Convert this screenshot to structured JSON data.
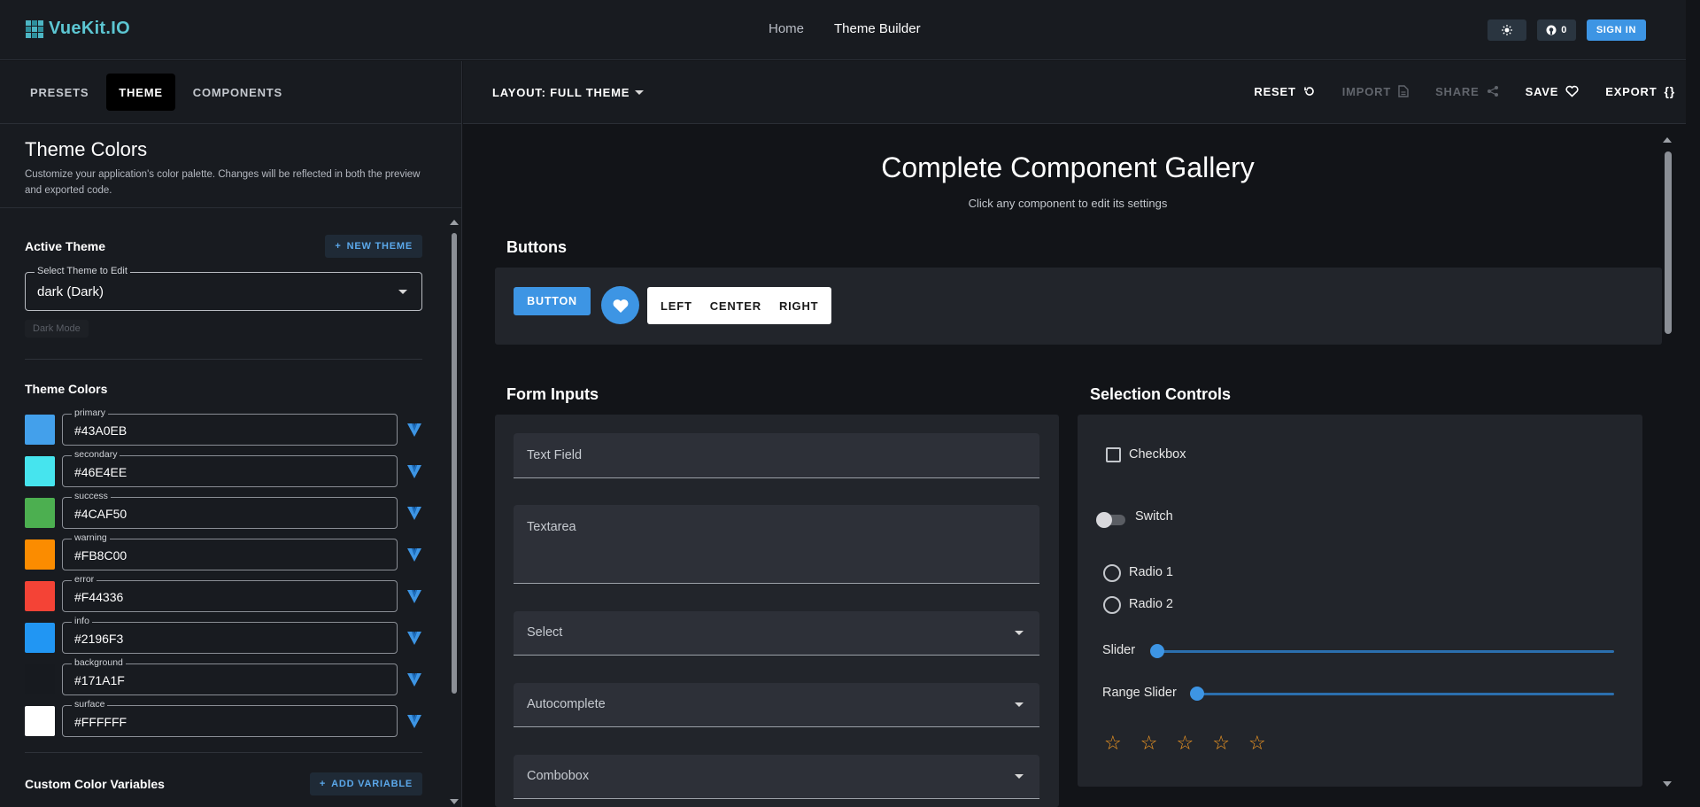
{
  "app": {
    "logo_text": "VueKit.IO",
    "nav": {
      "home": "Home",
      "theme_builder": "Theme Builder"
    },
    "github_count": "0",
    "sign_in": "SIGN IN"
  },
  "left_panel": {
    "tabs": [
      "PRESETS",
      "THEME",
      "COMPONENTS"
    ],
    "active_tab": "THEME",
    "heading": "Theme Colors",
    "description": "Customize your application's color palette. Changes will be reflected in both the preview and exported code.",
    "active_theme": {
      "title": "Active Theme",
      "new_theme_label": "NEW THEME",
      "select_legend": "Select Theme to Edit",
      "select_value": "dark (Dark)",
      "dark_mode_chip": "Dark Mode"
    },
    "theme_colors_title": "Theme Colors",
    "colors": [
      {
        "name": "primary",
        "value": "#43A0EB",
        "swatch": "#43A0EB"
      },
      {
        "name": "secondary",
        "value": "#46E4EE",
        "swatch": "#46E4EE"
      },
      {
        "name": "success",
        "value": "#4CAF50",
        "swatch": "#4CAF50"
      },
      {
        "name": "warning",
        "value": "#FB8C00",
        "swatch": "#FB8C00"
      },
      {
        "name": "error",
        "value": "#F44336",
        "swatch": "#F44336"
      },
      {
        "name": "info",
        "value": "#2196F3",
        "swatch": "#2196F3"
      },
      {
        "name": "background",
        "value": "#171A1F",
        "swatch": "#171A1F"
      },
      {
        "name": "surface",
        "value": "#FFFFFF",
        "swatch": "#FFFFFF"
      }
    ],
    "custom_vars_title": "Custom Color Variables",
    "add_variable_label": "ADD VARIABLE"
  },
  "toolbar": {
    "layout_label": "LAYOUT: FULL THEME",
    "actions": {
      "reset": "RESET",
      "import": "IMPORT",
      "share": "SHARE",
      "save": "SAVE",
      "export": "EXPORT"
    }
  },
  "gallery": {
    "title": "Complete Component Gallery",
    "subtitle": "Click any component to edit its settings",
    "buttons_section": {
      "title": "Buttons",
      "primary_label": "BUTTON",
      "group": [
        "LEFT",
        "CENTER",
        "RIGHT"
      ]
    },
    "form_inputs": {
      "title": "Form Inputs",
      "fields": [
        "Text Field",
        "Textarea",
        "Select",
        "Autocomplete",
        "Combobox"
      ]
    },
    "selection_controls": {
      "title": "Selection Controls",
      "checkbox": "Checkbox",
      "switch": "Switch",
      "radios": [
        "Radio 1",
        "Radio 2"
      ],
      "slider": "Slider",
      "range_slider": "Range Slider",
      "slider_value": 0,
      "range_slider_value": 0,
      "rating_value": 0,
      "rating_max": 5
    }
  },
  "colors": {
    "accent": "#3D95E4",
    "star": "#F59A23"
  }
}
